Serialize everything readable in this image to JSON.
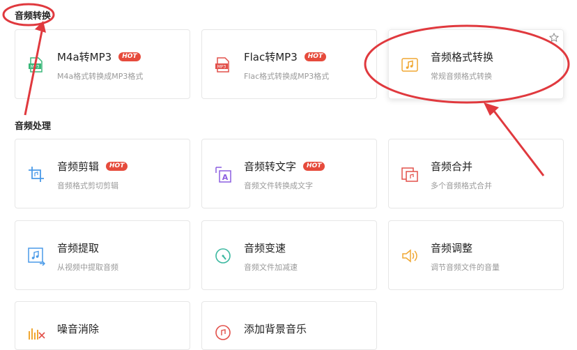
{
  "sections": [
    {
      "title": "音频转换"
    },
    {
      "title": "音频处理"
    }
  ],
  "cards": [
    {
      "title": "M4a转MP3",
      "desc": "M4a格式转换成MP3格式",
      "hot": "HOT",
      "icon": "m4a-mp3-icon",
      "color": "#3bb87a"
    },
    {
      "title": "Flac转MP3",
      "desc": "Flac格式转换成MP3格式",
      "hot": "HOT",
      "icon": "flac-mp3-icon",
      "color": "#e2504a"
    },
    {
      "title": "音频格式转换",
      "desc": "常规音频格式转换",
      "icon": "music-convert-icon",
      "color": "#f0a732"
    },
    {
      "title": "音频剪辑",
      "desc": "音频格式剪切剪辑",
      "hot": "HOT",
      "icon": "crop-icon",
      "color": "#4a9ae8"
    },
    {
      "title": "音频转文字",
      "desc": "音频文件转换成文字",
      "hot": "HOT",
      "icon": "text-a-icon",
      "color": "#8c5ee0"
    },
    {
      "title": "音频合并",
      "desc": "多个音频格式合并",
      "icon": "merge-icon",
      "color": "#e2504a"
    },
    {
      "title": "音频提取",
      "desc": "从视频中提取音频",
      "icon": "extract-icon",
      "color": "#4a9ae8"
    },
    {
      "title": "音频变速",
      "desc": "音频文件加减速",
      "icon": "speed-dial-icon",
      "color": "#3bb8a0"
    },
    {
      "title": "音频调整",
      "desc": "调节音频文件的音量",
      "icon": "speaker-volume-icon",
      "color": "#f0a732"
    },
    {
      "title": "噪音消除",
      "desc": "",
      "icon": "noise-removal-icon",
      "color": "#f0a732"
    },
    {
      "title": "添加背景音乐",
      "desc": "",
      "icon": "background-music-icon",
      "color": "#e2504a"
    }
  ],
  "colors": {
    "annotation": "#e0393e",
    "hot": "#e64b3c"
  }
}
